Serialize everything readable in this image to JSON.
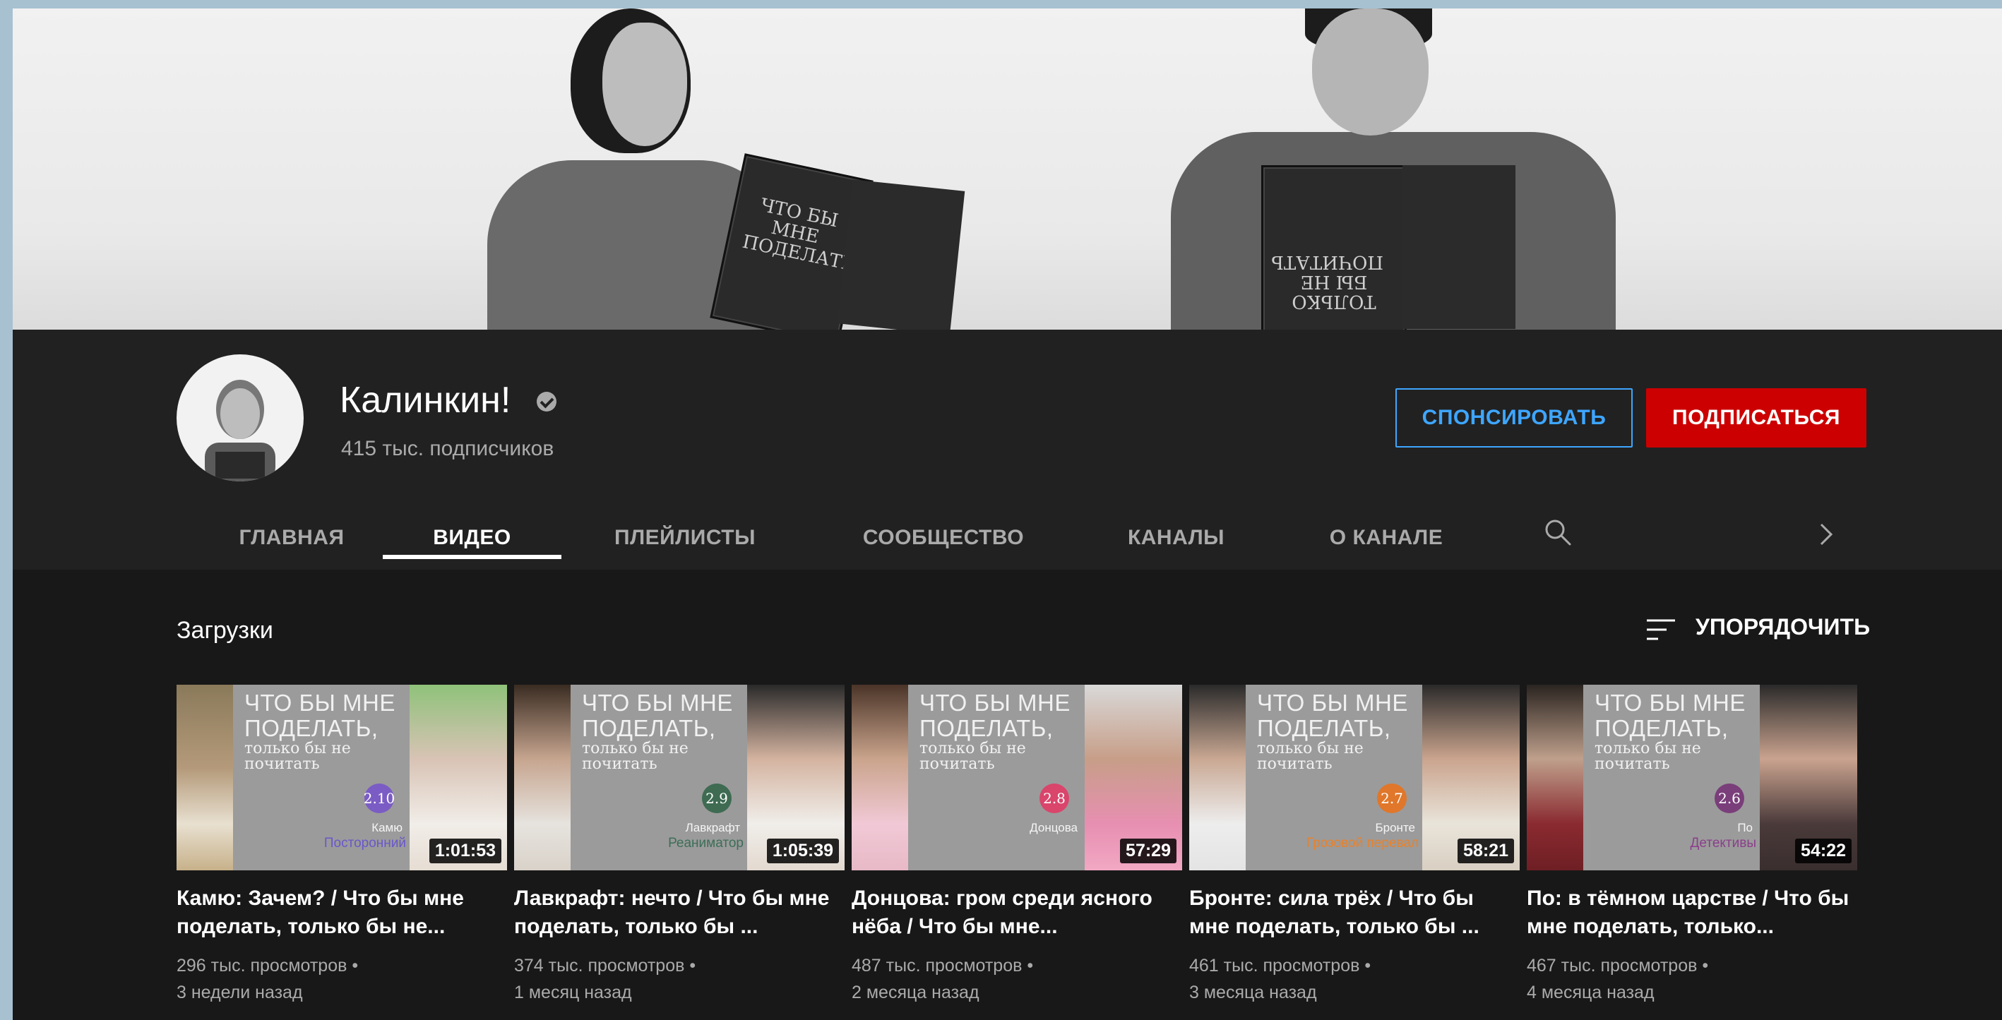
{
  "banner": {
    "book_left_text": "ЧТО БЫ МНЕ ПОДЕЛАТЬ",
    "book_right_text": "ТОЛЬКО БЫ НЕ ПОЧИТАТЬ"
  },
  "channel": {
    "name": "Калинкин!",
    "subscribers": "415 тыс. подписчиков",
    "sponsor_label": "СПОНСИРОВАТЬ",
    "subscribe_label": "ПОДПИСАТЬСЯ"
  },
  "tabs": [
    {
      "label": "ГЛАВНАЯ"
    },
    {
      "label": "ВИДЕО"
    },
    {
      "label": "ПЛЕЙЛИСТЫ"
    },
    {
      "label": "СООБЩЕСТВО"
    },
    {
      "label": "КАНАЛЫ"
    },
    {
      "label": "О КАНАЛЕ"
    }
  ],
  "icons": {
    "search": "search-icon",
    "chevron": "chevron-right-icon",
    "sort": "sort-icon",
    "verified": "verified-icon"
  },
  "section": {
    "uploads_label": "Загрузки",
    "sort_label": "УПОРЯДОЧИТЬ"
  },
  "videos": [
    {
      "cover_title": "ЧТО БЫ МНЕ ПОДЕЛАТЬ,",
      "cover_sub": "только бы не почитать",
      "number": "2.10",
      "number_color": "#7b5cc4",
      "author": "Камю",
      "book": "Посторонний",
      "book_color": "#6a57c9",
      "duration": "1:01:53",
      "title": "Камю: Зачем? / Что бы мне поделать, только бы не...",
      "views": "296 тыс. просмотров •",
      "age": "3 недели назад"
    },
    {
      "cover_title": "ЧТО БЫ МНЕ ПОДЕЛАТЬ,",
      "cover_sub": "только бы не почитать",
      "number": "2.9",
      "number_color": "#3e6b52",
      "author": "Лавкрафт",
      "book": "Реаниматор",
      "book_color": "#3d6e57",
      "duration": "1:05:39",
      "title": "Лавкрафт: нечто / Что бы мне поделать, только бы ...",
      "views": "374 тыс. просмотров •",
      "age": "1 месяц назад"
    },
    {
      "cover_title": "ЧТО БЫ МНЕ ПОДЕЛАТЬ,",
      "cover_sub": "только бы не почитать",
      "number": "2.8",
      "number_color": "#d9456b",
      "author": "Донцова",
      "book": "",
      "book_color": "#d9456b",
      "duration": "57:29",
      "title": "Донцова: гром среди ясного нёба / Что бы мне...",
      "views": "487 тыс. просмотров •",
      "age": "2 месяца назад"
    },
    {
      "cover_title": "ЧТО БЫ МНЕ ПОДЕЛАТЬ,",
      "cover_sub": "только бы не почитать",
      "number": "2.7",
      "number_color": "#e0772a",
      "author": "Бронте",
      "book": "Грозовой перевал",
      "book_color": "#e8822c",
      "duration": "58:21",
      "title": "Бронте: сила трёх / Что бы мне поделать, только бы ...",
      "views": "461 тыс. просмотров •",
      "age": "3 месяца назад"
    },
    {
      "cover_title": "ЧТО БЫ МНЕ ПОДЕЛАТЬ,",
      "cover_sub": "только бы не почитать",
      "number": "2.6",
      "number_color": "#7a3e7a",
      "author": "По",
      "book": "Детективы",
      "book_color": "#8a3f8a",
      "duration": "54:22",
      "title": "По: в тёмном царстве / Что бы мне поделать, только...",
      "views": "467 тыс. просмотров •",
      "age": "4 месяца назад"
    }
  ]
}
